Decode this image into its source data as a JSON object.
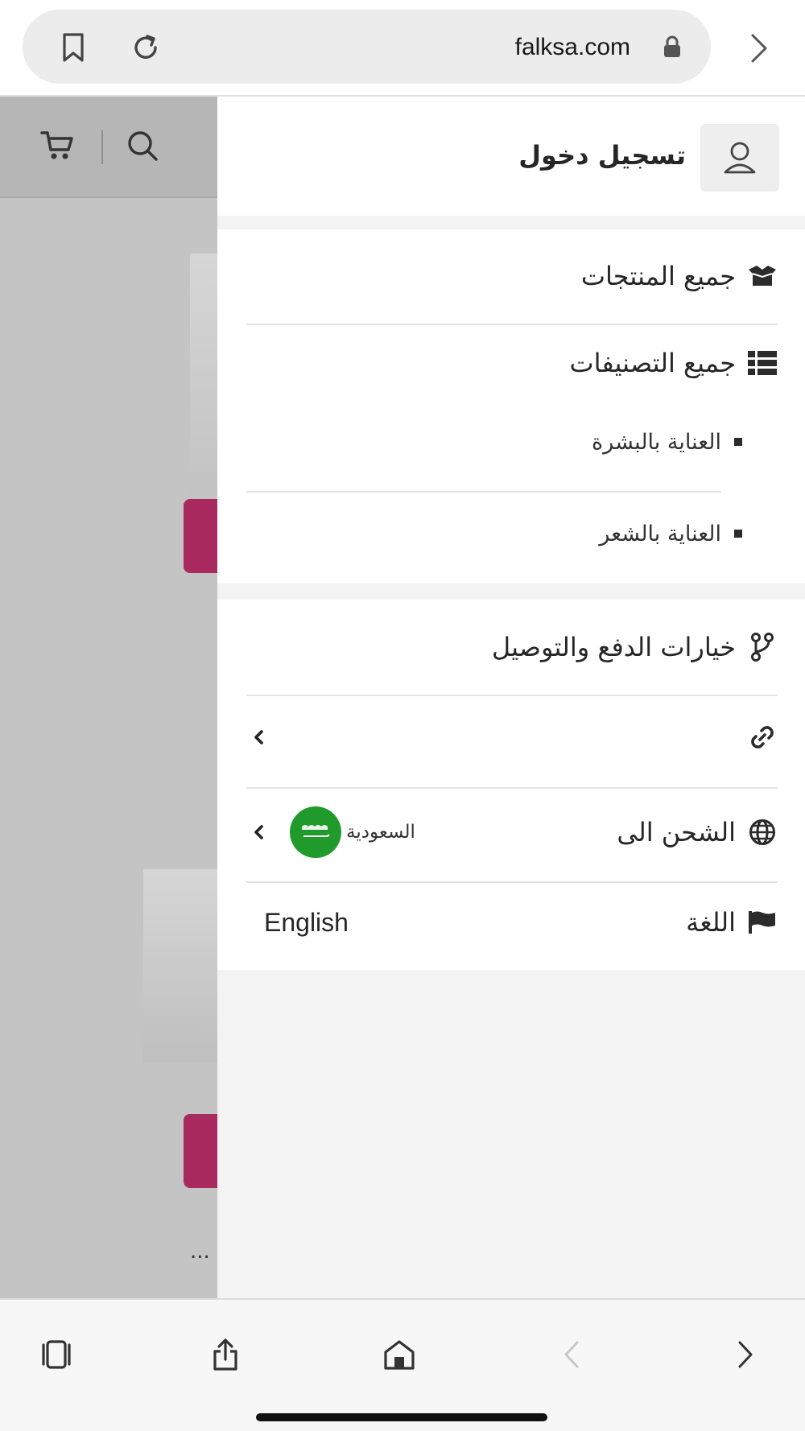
{
  "browser": {
    "url": "falksa.com",
    "bookmark_icon": "bookmark-icon",
    "reload_icon": "reload-icon",
    "lock_icon": "lock-icon",
    "forward_icon": "chevron-right-icon"
  },
  "background_page": {
    "more_text": "..."
  },
  "drawer": {
    "login_label": "تسجيل دخول",
    "all_products": "جميع المنتجات",
    "all_categories": "جميع التصنيفات",
    "categories": [
      "العناية بالبشرة",
      "العناية بالشعر"
    ],
    "payment_shipping": "خيارات الدفع والتوصيل",
    "ship_to_label": "الشحن الى",
    "ship_to_country": "السعودية",
    "language_label": "اللغة",
    "language_value": "English"
  },
  "colors": {
    "accent_pink": "#a92a5f",
    "flag_green": "#1f9a2b"
  }
}
